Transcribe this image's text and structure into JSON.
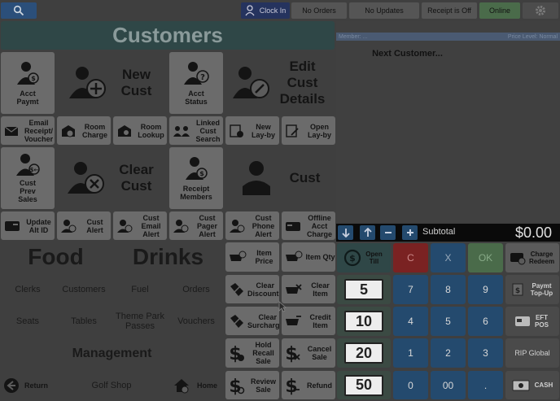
{
  "topbar": {
    "clock_in": "Clock In",
    "no_orders": "No Orders",
    "no_updates": "No Updates",
    "receipt_status": "Receipt is Off",
    "connection": "Online"
  },
  "title": "Customers",
  "customer_tiles": {
    "acct_paymt": "Acct Paymt",
    "new_cust": "New Cust",
    "acct_status": "Acct Status",
    "edit_cust_details": "Edit Cust Details",
    "email_receipt": "Email Receipt/ Voucher",
    "room_charge": "Room Charge",
    "room_lookup": "Room Lookup",
    "linked_cust_search": "Linked Cust Search",
    "new_layby": "New Lay-by",
    "open_layby": "Open Lay-by",
    "cust_prev_sales": "Cust Prev Sales",
    "clear_cust": "Clear Cust",
    "receipt_members": "Receipt Members",
    "cust": "Cust",
    "update_alt_id": "Update Alt ID",
    "cust_alert": "Cust Alert",
    "cust_email_alert": "Cust Email Alert",
    "cust_pager_alert": "Cust Pager Alert",
    "cust_phone_alert": "Cust Phone Alert",
    "offline_acct_charge": "Offline Acct Charge"
  },
  "categories": {
    "food": "Food",
    "drinks": "Drinks",
    "clerks": "Clerks",
    "customers": "Customers",
    "fuel": "Fuel",
    "orders": "Orders",
    "seats": "Seats",
    "tables": "Tables",
    "theme_park_passes": "Theme Park Passes",
    "vouchers": "Vouchers",
    "management": "Management",
    "return": "Return",
    "golf_shop": "Golf Shop",
    "home": "Home"
  },
  "item_actions": {
    "item_price": "Item Price",
    "item_qty": "Item Qty",
    "clear_discounts": "Clear Discounts",
    "clear_item": "Clear Item",
    "clear_surcharges": "Clear Surcharges",
    "credit_item": "Credit Item",
    "hold_recall_sale": "Hold Recall Sale",
    "cancel_sale": "Cancel Sale",
    "review_sale": "Review Sale",
    "refund": "Refund"
  },
  "receipt": {
    "member": "Member: ...",
    "price_level": "Price Level: Normal",
    "next_customer": "Next Customer..."
  },
  "subtotal": {
    "label": "Subtotal",
    "amount": "$0.00"
  },
  "keypad": {
    "open_till": "Open Till",
    "c": "C",
    "x": "X",
    "ok": "OK",
    "charge_redeem": "Charge Redeem",
    "note5": "5",
    "note10": "10",
    "note20": "20",
    "note50": "50",
    "k7": "7",
    "k8": "8",
    "k9": "9",
    "k4": "4",
    "k5": "5",
    "k6": "6",
    "k1": "1",
    "k2": "2",
    "k3": "3",
    "k0": "0",
    "k00": "00",
    "kdot": ".",
    "paymt_topup": "Paymt Top-Up",
    "eft_pos": "EFT POS",
    "rip_global": "RIP Global",
    "cash": "CASH"
  },
  "colors": {
    "background": "#3f3f3f",
    "title_bar": "#2f4747",
    "accent_blue": "#244a6e",
    "clear_red": "#7a2222",
    "ok_green": "#4a6b4a"
  }
}
